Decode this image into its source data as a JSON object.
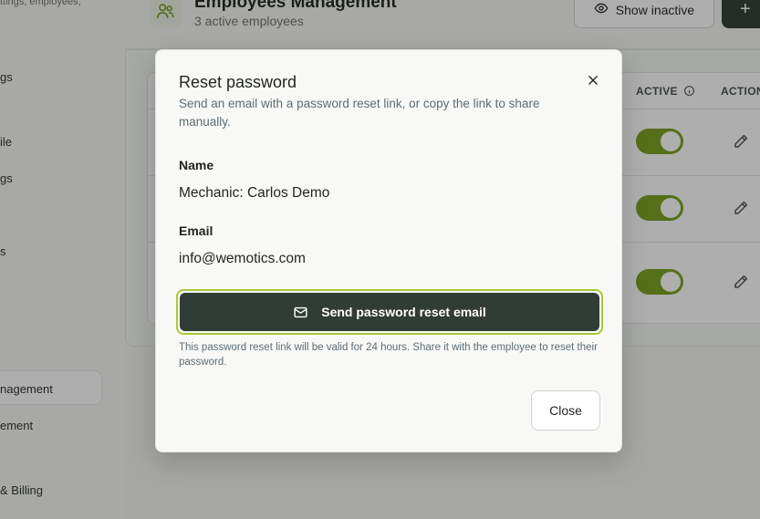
{
  "sidebar": {
    "subtitle": "ttings, employees,",
    "items": [
      {
        "label": "gs"
      },
      {
        "label": "ile"
      },
      {
        "label": "gs"
      },
      {
        "label": "s"
      },
      {
        "label": "nagement"
      },
      {
        "label": "ement"
      },
      {
        "label": "& Billing"
      }
    ]
  },
  "header": {
    "title": "Employees Management",
    "subtitle": "3 active employees",
    "show_inactive_label": "Show inactive",
    "add_label": "+"
  },
  "table": {
    "columns": [
      "ACTIVE",
      "ACTION"
    ],
    "rows": [
      {
        "active": true
      },
      {
        "active": true
      },
      {
        "active": true
      }
    ]
  },
  "modal": {
    "title": "Reset password",
    "description": "Send an email with a password reset link, or copy the link to share manually.",
    "name_label": "Name",
    "name_value": "Mechanic: Carlos Demo",
    "email_label": "Email",
    "email_value": "info@wemotics.com",
    "send_button_label": "Send password reset email",
    "note": "This password reset link will be valid for 24 hours. Share it with the employee to reset their password.",
    "close_button_label": "Close"
  },
  "colors": {
    "accent": "#7a9e1c",
    "primary_button": "#303d35",
    "focus_ring": "#a6c93a"
  }
}
